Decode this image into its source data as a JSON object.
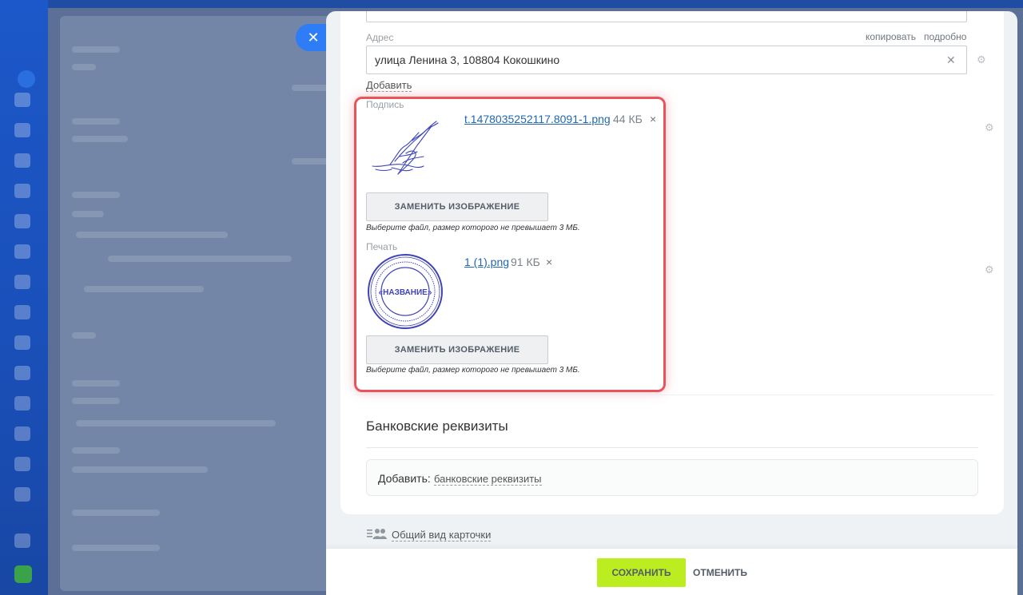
{
  "address": {
    "label": "Адрес",
    "copy_link": "копировать",
    "details_link": "подробно",
    "value": "улица Ленина 3, 108804 Кокошкино",
    "add_link": "Добавить"
  },
  "signature": {
    "label": "Подпись",
    "file_name": "t.1478035252117.8091-1.png",
    "file_size": "44 КБ",
    "replace_button": "ЗАМЕНИТЬ ИЗОБРАЖЕНИЕ",
    "hint": "Выберите файл, размер которого не превышает 3 МБ."
  },
  "stamp": {
    "label": "Печать",
    "file_name": "1 (1).png",
    "file_size": "91 КБ",
    "replace_button": "ЗАМЕНИТЬ ИЗОБРАЖЕНИЕ",
    "hint": "Выберите файл, размер которого не превышает 3 МБ.",
    "image_text": "«НАЗВАНИЕ»"
  },
  "bank": {
    "title": "Банковские реквизиты",
    "add_label": "Добавить:",
    "add_link": "банковские реквизиты"
  },
  "card_view": {
    "link": "Общий вид карточки"
  },
  "footer": {
    "save_label": "СОХРАНИТЬ",
    "cancel_label": "ОТМЕНИТЬ"
  },
  "colors": {
    "accent_save": "#bbed21",
    "highlight": "#e8545c",
    "link": "#2067b0",
    "close_button": "#2e7cf6"
  }
}
